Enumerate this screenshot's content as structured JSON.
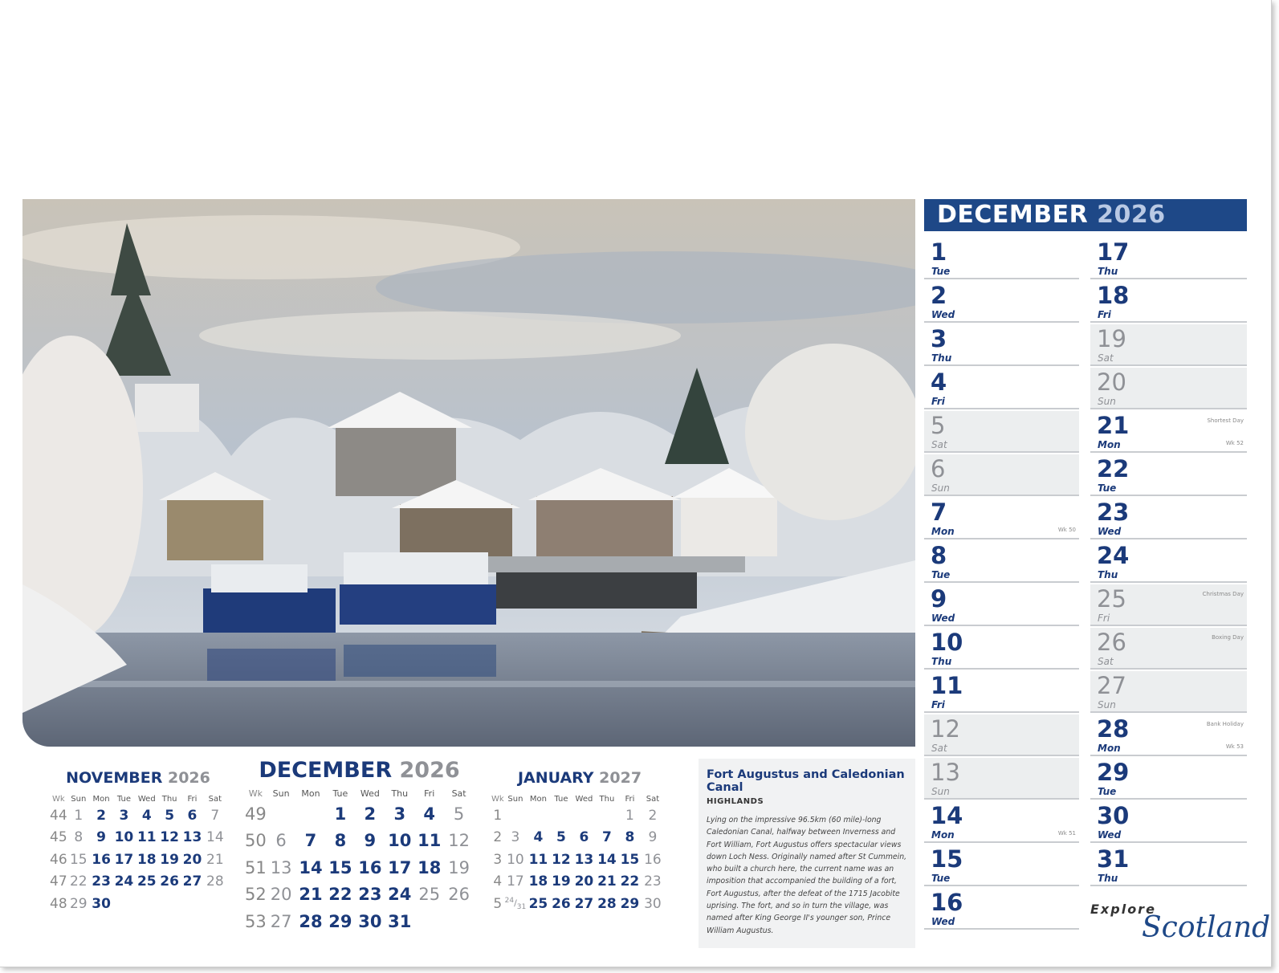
{
  "photo": {
    "subject": "snowy village by a canal with boats"
  },
  "month_header": {
    "month": "DECEMBER",
    "year": "2026"
  },
  "days_left": [
    {
      "num": "1",
      "name": "Tue",
      "we": false
    },
    {
      "num": "2",
      "name": "Wed",
      "we": false
    },
    {
      "num": "3",
      "name": "Thu",
      "we": false
    },
    {
      "num": "4",
      "name": "Fri",
      "we": false
    },
    {
      "num": "5",
      "name": "Sat",
      "we": true
    },
    {
      "num": "6",
      "name": "Sun",
      "we": true
    },
    {
      "num": "7",
      "name": "Mon",
      "we": false,
      "wk": "Wk 50"
    },
    {
      "num": "8",
      "name": "Tue",
      "we": false
    },
    {
      "num": "9",
      "name": "Wed",
      "we": false
    },
    {
      "num": "10",
      "name": "Thu",
      "we": false
    },
    {
      "num": "11",
      "name": "Fri",
      "we": false
    },
    {
      "num": "12",
      "name": "Sat",
      "we": true
    },
    {
      "num": "13",
      "name": "Sun",
      "we": true
    },
    {
      "num": "14",
      "name": "Mon",
      "we": false,
      "wk": "Wk 51"
    },
    {
      "num": "15",
      "name": "Tue",
      "we": false
    },
    {
      "num": "16",
      "name": "Wed",
      "we": false
    }
  ],
  "days_right": [
    {
      "num": "17",
      "name": "Thu",
      "we": false
    },
    {
      "num": "18",
      "name": "Fri",
      "we": false
    },
    {
      "num": "19",
      "name": "Sat",
      "we": true
    },
    {
      "num": "20",
      "name": "Sun",
      "we": true
    },
    {
      "num": "21",
      "name": "Mon",
      "we": false,
      "hol": "Shortest Day",
      "wk": "Wk 52"
    },
    {
      "num": "22",
      "name": "Tue",
      "we": false
    },
    {
      "num": "23",
      "name": "Wed",
      "we": false
    },
    {
      "num": "24",
      "name": "Thu",
      "we": false
    },
    {
      "num": "25",
      "name": "Fri",
      "we": true,
      "hol": "Christmas Day"
    },
    {
      "num": "26",
      "name": "Sat",
      "we": true,
      "hol": "Boxing Day"
    },
    {
      "num": "27",
      "name": "Sun",
      "we": true
    },
    {
      "num": "28",
      "name": "Mon",
      "we": false,
      "hol": "Bank Holiday",
      "wk": "Wk 53"
    },
    {
      "num": "29",
      "name": "Tue",
      "we": false
    },
    {
      "num": "30",
      "name": "Wed",
      "we": false
    },
    {
      "num": "31",
      "name": "Thu",
      "we": false
    }
  ],
  "logo": {
    "explore": "Explore",
    "scotland": "Scotland"
  },
  "mini_calendars": {
    "headers": [
      "Wk",
      "Sun",
      "Mon",
      "Tue",
      "Wed",
      "Thu",
      "Fri",
      "Sat"
    ],
    "nov": {
      "month": "NOVEMBER",
      "year": "2026",
      "rows": [
        [
          "44",
          "1",
          "2",
          "3",
          "4",
          "5",
          "6",
          "7"
        ],
        [
          "45",
          "8",
          "9",
          "10",
          "11",
          "12",
          "13",
          "14"
        ],
        [
          "46",
          "15",
          "16",
          "17",
          "18",
          "19",
          "20",
          "21"
        ],
        [
          "47",
          "22",
          "23",
          "24",
          "25",
          "26",
          "27",
          "28"
        ],
        [
          "48",
          "29",
          "30",
          "",
          "",
          "",
          "",
          ""
        ]
      ]
    },
    "dec": {
      "month": "DECEMBER",
      "year": "2026",
      "rows": [
        [
          "49",
          "",
          "",
          "1",
          "2",
          "3",
          "4",
          "5"
        ],
        [
          "50",
          "6",
          "7",
          "8",
          "9",
          "10",
          "11",
          "12"
        ],
        [
          "51",
          "13",
          "14",
          "15",
          "16",
          "17",
          "18",
          "19"
        ],
        [
          "52",
          "20",
          "21",
          "22",
          "23",
          "24",
          "25",
          "26"
        ],
        [
          "53",
          "27",
          "28",
          "29",
          "30",
          "31",
          "",
          ""
        ]
      ],
      "grey_cells": [
        "25",
        "26"
      ]
    },
    "jan": {
      "month": "JANUARY",
      "year": "2027",
      "rows": [
        [
          "1",
          "",
          "",
          "",
          "",
          "",
          "1",
          "2"
        ],
        [
          "2",
          "3",
          "4",
          "5",
          "6",
          "7",
          "8",
          "9"
        ],
        [
          "3",
          "10",
          "11",
          "12",
          "13",
          "14",
          "15",
          "16"
        ],
        [
          "4",
          "17",
          "18",
          "19",
          "20",
          "21",
          "22",
          "23"
        ],
        [
          "5",
          "24/31",
          "25",
          "26",
          "27",
          "28",
          "29",
          "30"
        ]
      ],
      "grey_cells": [
        "1"
      ]
    }
  },
  "caption": {
    "title": "Fort Augustus and Caledonian Canal",
    "subtitle": "HIGHLANDS",
    "body": "Lying on the impressive 96.5km (60 mile)-long Caledonian Canal, halfway between Inverness and Fort William, Fort Augustus offers spectacular views down Loch Ness. Originally named after St Cummein, who built a church here, the current name was an imposition that accompanied the building of a fort, Fort Augustus, after the defeat of the 1715 Jacobite uprising. The fort, and so in turn the village, was named after King George II's younger son, Prince William Augustus."
  },
  "colors": {
    "navy": "#1e4887",
    "text_navy": "#1b3a7a",
    "grey": "#8f9196",
    "weekend_bg": "#eceeef"
  }
}
